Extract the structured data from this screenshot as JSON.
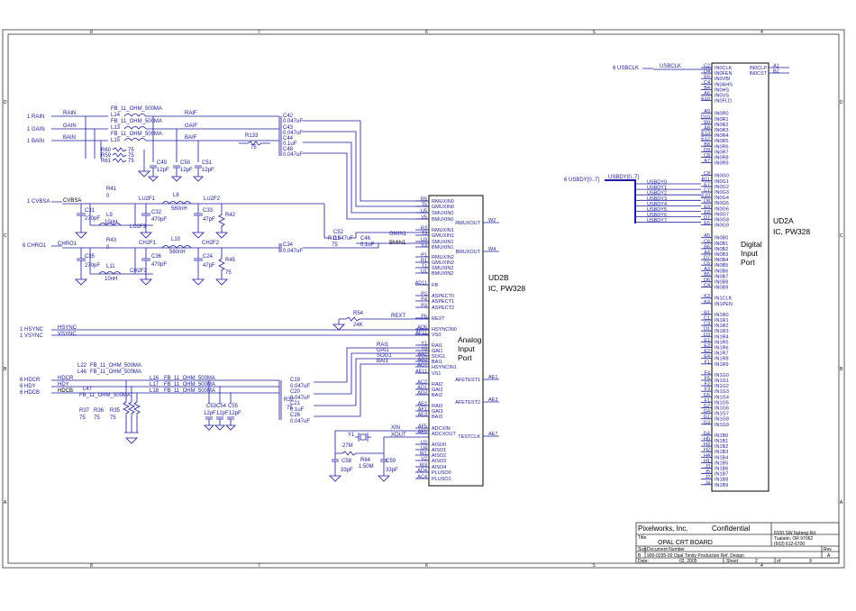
{
  "title_block": {
    "company": "Pixelworks, Inc.",
    "confidential": "Confidential",
    "address_1": "8100 SW Nyberg Rd.",
    "address_2": "Tualatin, OR 97062",
    "phone": "(503) 612-6700",
    "title_label": "Title",
    "title": "OPAL CRT BOARD",
    "size_label": "Size",
    "size": "B",
    "docnum_label": "Document Number",
    "docnum": "900-0295-00 Opal Trinity Production Ref. Design",
    "rev_label": "Rev",
    "rev": "A",
    "date_label": "Date:",
    "date": "02, 2005",
    "sheet_label": "Sheet",
    "sheet": "2",
    "of_label": "of",
    "of": "9"
  },
  "chips": {
    "ud2b": {
      "ref": "UD2B",
      "part": "IC, PW328",
      "func1": "Analog",
      "func2": "Input",
      "func3": "Port"
    },
    "ud2a": {
      "ref": "UD2A",
      "part": "IC, PW328",
      "func1": "Digital",
      "func2": "Input",
      "func3": "Port"
    }
  },
  "ports": {
    "rain": "1  RAIN",
    "gain": "1  GAIN",
    "bain": "1  BAIN",
    "cvbsa": "1  CVBSA",
    "chro1": "6  CHRO1",
    "hsync": "1  HSYNC",
    "vsync": "1  VSYNC",
    "hdcr": "6  HDCR",
    "hdy": "6  HDY",
    "hdcb": "6  HDCB",
    "usbclk": "6  USBCLK",
    "usbdy": "6  USBDY[0..7]"
  },
  "nets": {
    "rain": "RAIN",
    "gain": "GAIN",
    "bain": "BAIN",
    "raif": "RAIF",
    "gaif": "GAIF",
    "baif": "BAIF",
    "cvbsa": "CVBSA",
    "chro1": "CHRO1",
    "lu2f1": "LU2F1",
    "lu2f2": "LU2F2",
    "lu2f3": "LU2F3",
    "ch2f1": "CH2F1",
    "ch2f2": "CH2F2",
    "ch2f3": "CH2F3",
    "hsync": "HSYNC",
    "vsync": "VSYNC",
    "hdcr": "HDCR",
    "hdy": "HDY",
    "hdcb": "HDCB",
    "rmin0": "RMIN0",
    "gmin0": "GMIN0",
    "smin0": "SMIN0",
    "bmin0": "BMIN0",
    "gmin1": "GMIN1",
    "bmin1": "BMIN1",
    "rext": "REXT",
    "rai1": "RAI1",
    "gai1": "GAI1",
    "sog1": "SOG1",
    "bai1": "BAI1",
    "xin": "XIN",
    "xout": "XOUT",
    "usbclk": "USBCLK",
    "usbdy_bus": "USBDY[0..7]"
  },
  "components": {
    "l14": "L14",
    "l13": "L13",
    "l15": "L15",
    "fb": "FB_11_OHM_500MA",
    "r60": "R60",
    "r59": "R59",
    "r61": "R61",
    "r75": "75",
    "c49": "C49",
    "c50": "C50",
    "c51": "C51",
    "c12pf": "12pF",
    "c42": "C42",
    "c43": "C43",
    "c44": "C44",
    "c47": "C47",
    "c48": "C48",
    "v047": "0.047uF",
    "v01": "0.1uF",
    "r133": "R133",
    "r41": "R41",
    "r43": "R43",
    "r0": "0",
    "c31": "C31",
    "c35": "C35",
    "c270": "270pF",
    "l9": "L9",
    "l11": "L11",
    "v10n": "10nH",
    "c32": "C32",
    "c36": "C36",
    "c470": "470pF",
    "l8": "L8",
    "l10": "L10",
    "v560": "560nH",
    "c33": "C33",
    "c24": "C24",
    "c47p": "47pF",
    "r42": "R42",
    "r45": "R45",
    "c34": "C34",
    "c52": "C52",
    "c46": "C46",
    "r115": "R115",
    "r54": "R54",
    "v24k": "24K",
    "l22": "L22",
    "l46": "L46",
    "l47": "L47",
    "l16": "L16",
    "l17": "L17",
    "l18": "L18",
    "r37": "R37",
    "r36": "R36",
    "r35": "R35",
    "c53": "C53",
    "c54": "C54",
    "c55": "C55",
    "c19": "C19",
    "c20": "C20",
    "c21": "C21",
    "c25": "C25",
    "c26": "C26",
    "r32": "R32",
    "y1": "Y1",
    "v27m": "27M",
    "r64": "R64",
    "v150m": "1.50M",
    "c58": "C58",
    "c59": "C59",
    "c33p": "33pF"
  },
  "ud2b_left_pins": [
    {
      "num": "R5",
      "name": "RMUXIN0"
    },
    {
      "num": "T5",
      "name": "GMUXIN0"
    },
    {
      "num": "U5",
      "name": "SMUXIN0"
    },
    {
      "num": "V5",
      "name": "BMUXIN0"
    },
    {
      "num": "R3",
      "name": "RMUXIN1"
    },
    {
      "num": "T3",
      "name": "GMUXIN1"
    },
    {
      "num": "U3",
      "name": "SMUXIN1"
    },
    {
      "num": "V3",
      "name": "BMUXIN1"
    },
    {
      "num": "P1",
      "name": "RMUXIN2"
    },
    {
      "num": "R1",
      "name": "GMUXIN2"
    },
    {
      "num": "T1",
      "name": "SMUXIN2"
    },
    {
      "num": "U1",
      "name": "BMUXIN2"
    },
    {
      "num": "AD11",
      "name": "FB"
    },
    {
      "num": "P2",
      "name": "ASPECT0"
    },
    {
      "num": "P4",
      "name": "ASPECT1"
    },
    {
      "num": "P3",
      "name": "ASPECT2"
    },
    {
      "num": "P6",
      "name": "REXT"
    },
    {
      "num": "AD6",
      "name": "HSYNCIN0"
    },
    {
      "num": "AF11",
      "name": "VS0"
    },
    {
      "num": "Y1",
      "name": "RAI1"
    },
    {
      "num": "Y3",
      "name": "GAI1"
    },
    {
      "num": "AA2",
      "name": "SOG1"
    },
    {
      "num": "AB3",
      "name": "BAI1"
    },
    {
      "num": "AC7",
      "name": "HSYNCIN1"
    },
    {
      "num": "AE11",
      "name": "VS1"
    },
    {
      "num": "AC2",
      "name": "RAI2"
    },
    {
      "num": "AD1",
      "name": "GAI2"
    },
    {
      "num": "AD3",
      "name": "BAI2"
    },
    {
      "num": "AE2",
      "name": "RAI3"
    },
    {
      "num": "AF1",
      "name": "GAI3"
    },
    {
      "num": "AE3",
      "name": "BAI3"
    },
    {
      "num": "AF5",
      "name": "ADCXIN"
    },
    {
      "num": "AE5",
      "name": "ADCXOUT"
    },
    {
      "num": "U2",
      "name": "AISO0"
    },
    {
      "num": "U4",
      "name": "AISO1"
    },
    {
      "num": "W1",
      "name": "AISO2"
    },
    {
      "num": "V2",
      "name": "AISO3"
    },
    {
      "num": "W3",
      "name": "AISO4"
    },
    {
      "num": "AD4",
      "name": "PLUSO0"
    },
    {
      "num": "AC4",
      "name": "PLUSO1"
    }
  ],
  "ud2b_right_pins": [
    {
      "num": "W2",
      "name": "RMUXOUT"
    },
    {
      "num": "W4",
      "name": "BMUXOUT"
    },
    {
      "num": "AE1",
      "name": "AFETEST1"
    },
    {
      "num": "AE3",
      "name": "AFETEST2"
    },
    {
      "num": "AE7",
      "name": "TESTCLK"
    }
  ],
  "ud2a_left_pins": [
    {
      "num": "C2",
      "name": "IN0CLK"
    },
    {
      "num": "D4",
      "name": "IN0FEN"
    },
    {
      "num": "E6",
      "name": "IN0VBI"
    },
    {
      "num": "C4",
      "name": "IN0AHS"
    },
    {
      "num": "B4",
      "name": "IN0HS"
    },
    {
      "num": "A6",
      "name": "IN0VS"
    },
    {
      "num": "E10",
      "name": "IN0FLD"
    },
    {
      "num": "A9",
      "name": "IN0R0"
    },
    {
      "num": "D10",
      "name": "IN0R1"
    },
    {
      "num": "B9",
      "name": "IN0R2"
    },
    {
      "num": "A8",
      "name": "IN0R3"
    },
    {
      "num": "E13",
      "name": "IN0R4"
    },
    {
      "num": "E12",
      "name": "IN0R5"
    },
    {
      "num": "B8",
      "name": "IN0R6"
    },
    {
      "num": "D9",
      "name": "IN0R7"
    },
    {
      "num": "C8",
      "name": "IN0R8"
    },
    {
      "num": "A7",
      "name": "IN0R9"
    },
    {
      "num": "C8",
      "name": "IN0G0"
    },
    {
      "num": "B11",
      "name": "IN0G1"
    },
    {
      "num": "E7",
      "name": "IN0G2"
    },
    {
      "num": "C7",
      "name": "IN0G3"
    },
    {
      "num": "E10",
      "name": "IN0G4"
    },
    {
      "num": "D8",
      "name": "IN0G5"
    },
    {
      "num": "E9",
      "name": "IN0G6"
    },
    {
      "num": "E8",
      "name": "IN0G7"
    },
    {
      "num": "D7",
      "name": "IN0G8"
    },
    {
      "num": "E6",
      "name": "IN0G9"
    },
    {
      "num": "A5",
      "name": "IN0B0"
    },
    {
      "num": "C6",
      "name": "IN0B1"
    },
    {
      "num": "B6",
      "name": "IN0B2"
    },
    {
      "num": "A4",
      "name": "IN0B3"
    },
    {
      "num": "D7",
      "name": "IN0B4"
    },
    {
      "num": "C5",
      "name": "IN0B5"
    },
    {
      "num": "A3",
      "name": "IN0B6"
    },
    {
      "num": "B5",
      "name": "IN0B7"
    },
    {
      "num": "D6",
      "name": "IN0B8"
    },
    {
      "num": "C4",
      "name": "IN0B9"
    },
    {
      "num": "K3",
      "name": "IN1CLK"
    },
    {
      "num": "K4",
      "name": "IN1PEN"
    },
    {
      "num": "B1",
      "name": "IN1R0"
    },
    {
      "num": "C1",
      "name": "IN1R1"
    },
    {
      "num": "C3",
      "name": "IN1R2"
    },
    {
      "num": "D1",
      "name": "IN1R3"
    },
    {
      "num": "D3",
      "name": "IN1R4"
    },
    {
      "num": "E1",
      "name": "IN1R5"
    },
    {
      "num": "E3",
      "name": "IN1R6"
    },
    {
      "num": "E2",
      "name": "IN1R7"
    },
    {
      "num": "E4",
      "name": "IN1R8"
    },
    {
      "num": "F1",
      "name": "IN1R9"
    },
    {
      "num": "F4",
      "name": "IN1G0"
    },
    {
      "num": "F5",
      "name": "IN1G1"
    },
    {
      "num": "F2",
      "name": "IN1G2"
    },
    {
      "num": "F3",
      "name": "IN1G3"
    },
    {
      "num": "G5",
      "name": "IN1G4"
    },
    {
      "num": "F1",
      "name": "IN1G5"
    },
    {
      "num": "G2",
      "name": "IN1G6"
    },
    {
      "num": "G4",
      "name": "IN1G7"
    },
    {
      "num": "G1",
      "name": "IN1G8"
    },
    {
      "num": "G3",
      "name": "IN1G9"
    },
    {
      "num": "G4",
      "name": "IN1B0"
    },
    {
      "num": "H5",
      "name": "IN1B1"
    },
    {
      "num": "H3",
      "name": "IN1B2"
    },
    {
      "num": "H2",
      "name": "IN1B3"
    },
    {
      "num": "H4",
      "name": "IN1B4"
    },
    {
      "num": "H1",
      "name": "IN1B5"
    },
    {
      "num": "J3",
      "name": "IN1B6"
    },
    {
      "num": "J5",
      "name": "IN1B7"
    },
    {
      "num": "J2",
      "name": "IN1B8"
    },
    {
      "num": "J4",
      "name": "IN1B9"
    }
  ],
  "ud2a_right_pins": [
    {
      "num": "A1",
      "name": "IN0CLP"
    },
    {
      "num": "B2",
      "name": "IN0CST"
    }
  ],
  "usbdy_nets": [
    "USBDY0",
    "USBDY1",
    "USBDY2",
    "USBDY3",
    "USBDY4",
    "USBDY5",
    "USBDY6",
    "USBDY7"
  ],
  "border": {
    "cols_top": [
      "8",
      "7",
      "6",
      "5",
      "4",
      "3",
      "2",
      "1"
    ],
    "rows_side": [
      "D",
      "C",
      "B",
      "A"
    ]
  }
}
